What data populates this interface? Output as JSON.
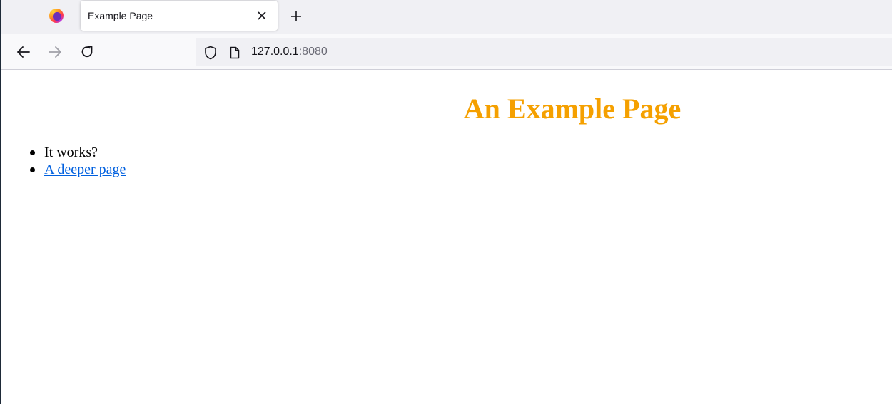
{
  "browser": {
    "tab": {
      "title": "Example Page"
    },
    "urlbar": {
      "host": "127.0.0.1",
      "port": ":8080"
    }
  },
  "icons": {
    "firefox": "firefox-logo-icon",
    "close": "close-icon",
    "new_tab": "plus-icon",
    "back": "arrow-left-icon",
    "forward": "arrow-right-icon",
    "reload": "reload-icon",
    "shield": "shield-icon",
    "page": "page-icon"
  },
  "page": {
    "heading": "An Example Page",
    "items": [
      {
        "text": "It works?"
      },
      {
        "text": "A deeper page"
      }
    ]
  },
  "colors": {
    "heading": "#f5a000",
    "link": "#0060df"
  }
}
